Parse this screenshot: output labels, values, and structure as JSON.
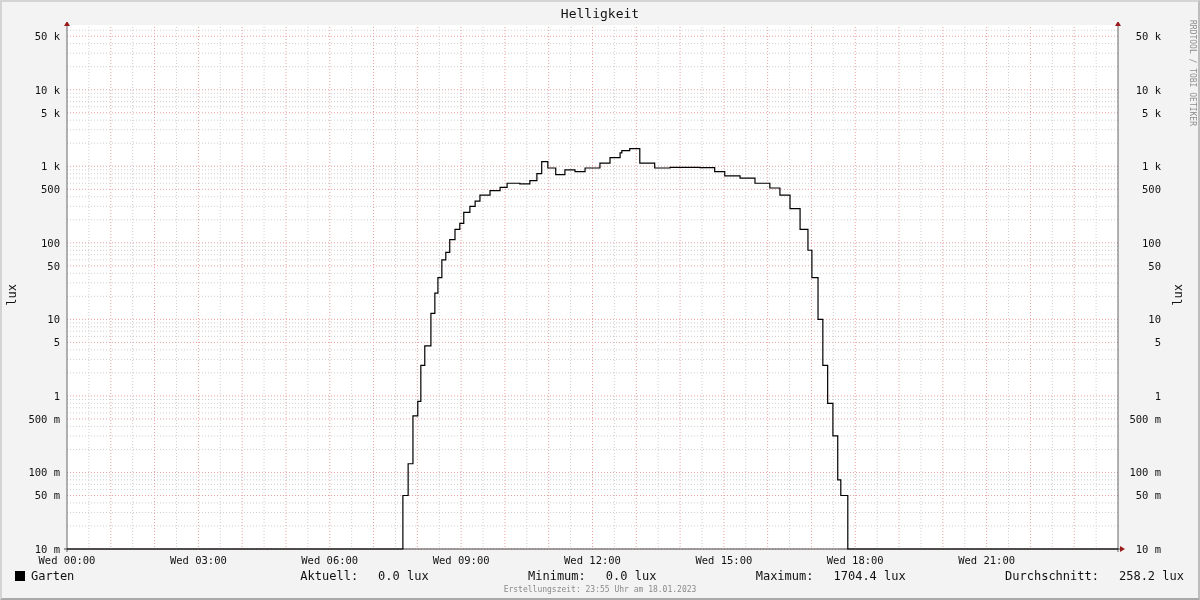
{
  "title": "Helligkeit",
  "plot": {
    "ylabel": "lux",
    "y_tick_labels": [
      "50 k",
      "10 k",
      "5 k",
      "1 k",
      "500",
      "100",
      "50",
      "10",
      "5",
      "1",
      "500 m",
      "100 m",
      "50 m",
      "10 m"
    ],
    "x_tick_labels": [
      "Wed 00:00",
      "Wed 03:00",
      "Wed 06:00",
      "Wed 09:00",
      "Wed 12:00",
      "Wed 15:00",
      "Wed 18:00",
      "Wed 21:00"
    ]
  },
  "right_axis": {
    "label": "lux",
    "tick_labels": [
      "50 k",
      "10 k",
      "5 k",
      "1 k",
      "500",
      "100",
      "50",
      "10",
      "5",
      "1",
      "500 m",
      "100 m",
      "50 m",
      "10 m"
    ]
  },
  "credit": "RRDTOOL / TOBI OETIKER",
  "legend": {
    "name": "Garten",
    "color": "#000000",
    "stats": [
      {
        "label": "Aktuell:",
        "value": "0.0 lux"
      },
      {
        "label": "Minimum:",
        "value": "0.0 lux"
      },
      {
        "label": "Maximum:",
        "value": "1704.4 lux"
      },
      {
        "label": "Durchschnitt:",
        "value": "258.2 lux"
      }
    ]
  },
  "footer": "Erstellungszeit: 23:55 Uhr am 18.01.2023"
}
